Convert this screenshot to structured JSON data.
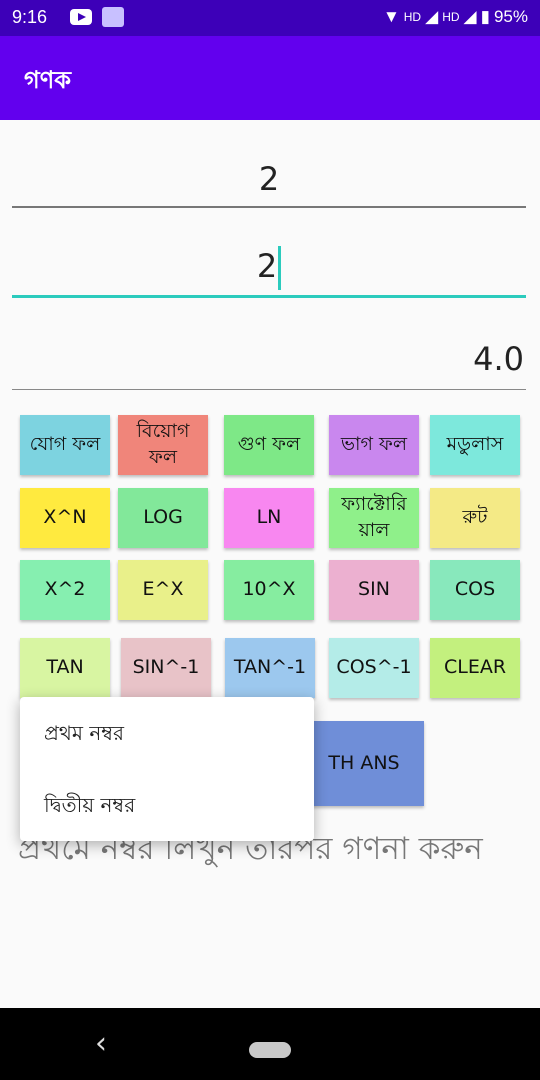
{
  "status_bar": {
    "time": "9:16",
    "hd1": "HD",
    "hd2": "HD",
    "battery": "95%"
  },
  "app_bar": {
    "title": "গণক"
  },
  "inputs": {
    "first_value": "2",
    "second_value": "2"
  },
  "result": {
    "value": "4.0"
  },
  "buttons": {
    "add": "যোগ ফল",
    "subtract_line1": "বিয়োগ",
    "subtract_line2": "ফল",
    "multiply": "গুণ ফল",
    "divide": "ভাগ ফল",
    "modulus": "মডুলাস",
    "x_pow_n": "X^N",
    "log": "LOG",
    "ln": "LN",
    "factorial_line1": "ফ্যাক্টোরি",
    "factorial_line2": "য়াল",
    "root": "রুট",
    "x_sq": "X^2",
    "e_x": "E^X",
    "ten_x": "10^X",
    "sin": "SIN",
    "cos": "COS",
    "tan": "TAN",
    "asin": "SIN^-1",
    "atan": "TAN^-1",
    "acos": "COS^-1",
    "clear": "CLEAR",
    "both_ans": "TH ANS"
  },
  "menu": {
    "item1": "প্রথম নম্বর",
    "item2": "দ্বিতীয় নম্বর"
  },
  "hint": "প্রথমে নম্বর লিখুন তারপর গণনা করুন",
  "colors": {
    "status_bar": "#3d00b8",
    "app_bar": "#6200ee",
    "accent": "#2bcbbd"
  }
}
